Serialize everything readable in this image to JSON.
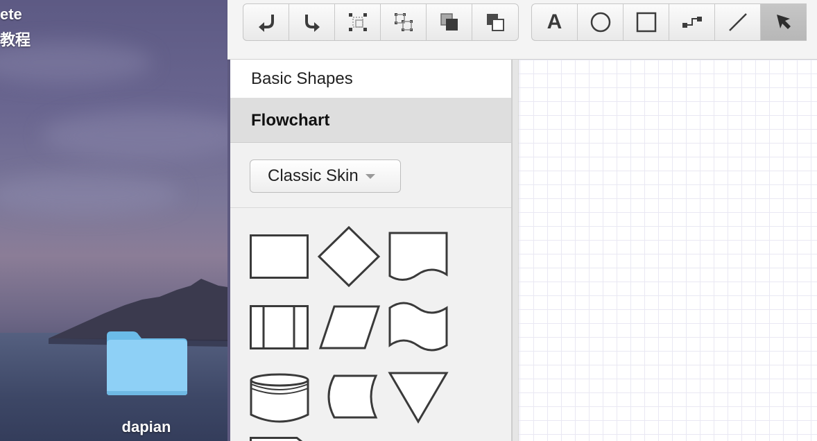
{
  "desktop": {
    "text_line1": "ete",
    "text_line2": "教程",
    "folder_label": "dapian"
  },
  "toolbar": {
    "groups": [
      {
        "buttons": [
          {
            "icon": "undo-icon",
            "label": ""
          },
          {
            "icon": "redo-icon",
            "label": ""
          },
          {
            "icon": "group-icon",
            "label": ""
          },
          {
            "icon": "ungroup-icon",
            "label": ""
          },
          {
            "icon": "bring-to-front-icon",
            "label": ""
          },
          {
            "icon": "send-to-back-icon",
            "label": ""
          }
        ]
      },
      {
        "buttons": [
          {
            "icon": "text-icon",
            "label": "A"
          },
          {
            "icon": "ellipse-icon",
            "label": ""
          },
          {
            "icon": "rectangle-icon",
            "label": ""
          },
          {
            "icon": "connector-icon",
            "label": ""
          },
          {
            "icon": "line-icon",
            "label": ""
          },
          {
            "icon": "pointer-icon",
            "label": "",
            "active": true
          }
        ]
      }
    ]
  },
  "sidebar": {
    "sections": [
      {
        "label": "Basic Shapes",
        "expanded": false
      },
      {
        "label": "Flowchart",
        "expanded": true
      }
    ],
    "skin_select": {
      "selected": "Classic Skin"
    },
    "shapes": [
      "process-shape-icon",
      "decision-shape-icon",
      "document-shape-icon",
      "predefined-process-shape-icon",
      "data-shape-icon",
      "punched-tape-shape-icon",
      "database-shape-icon",
      "stored-data-shape-icon",
      "merge-shape-icon"
    ]
  },
  "colors": {
    "toolbar_bg": "#f4f4f4",
    "active_button": "#bbbbbb",
    "sidebar_bg": "#f1f1f1",
    "section_active_bg": "#dedede",
    "grid_line": "#e9e8f3",
    "shape_stroke": "#3a3a3a"
  }
}
